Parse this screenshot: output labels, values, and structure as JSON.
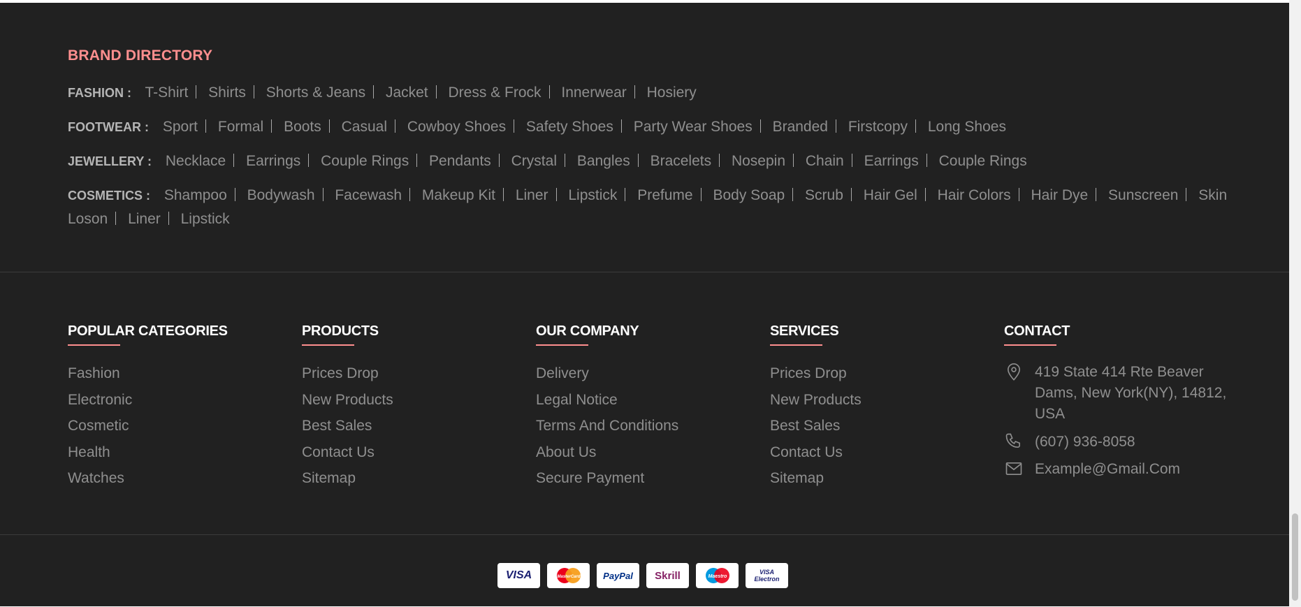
{
  "brand_directory": {
    "title": "BRAND DIRECTORY",
    "rows": [
      {
        "label": "FASHION :",
        "items": [
          "T-Shirt",
          "Shirts",
          "Shorts & Jeans",
          "Jacket",
          "Dress & Frock",
          "Innerwear",
          "Hosiery"
        ]
      },
      {
        "label": "FOOTWEAR :",
        "items": [
          "Sport",
          "Formal",
          "Boots",
          "Casual",
          "Cowboy Shoes",
          "Safety Shoes",
          "Party Wear Shoes",
          "Branded",
          "Firstcopy",
          "Long Shoes"
        ]
      },
      {
        "label": "JEWELLERY :",
        "items": [
          "Necklace",
          "Earrings",
          "Couple Rings",
          "Pendants",
          "Crystal",
          "Bangles",
          "Bracelets",
          "Nosepin",
          "Chain",
          "Earrings",
          "Couple Rings"
        ]
      },
      {
        "label": "COSMETICS :",
        "items": [
          "Shampoo",
          "Bodywash",
          "Facewash",
          "Makeup Kit",
          "Liner",
          "Lipstick",
          "Prefume",
          "Body Soap",
          "Scrub",
          "Hair Gel",
          "Hair Colors",
          "Hair Dye",
          "Sunscreen",
          "Skin Loson",
          "Liner",
          "Lipstick"
        ]
      }
    ]
  },
  "columns": {
    "popular": {
      "title": "POPULAR CATEGORIES",
      "items": [
        "Fashion",
        "Electronic",
        "Cosmetic",
        "Health",
        "Watches"
      ]
    },
    "products": {
      "title": "PRODUCTS",
      "items": [
        "Prices Drop",
        "New Products",
        "Best Sales",
        "Contact Us",
        "Sitemap"
      ]
    },
    "company": {
      "title": "OUR COMPANY",
      "items": [
        "Delivery",
        "Legal Notice",
        "Terms And Conditions",
        "About Us",
        "Secure Payment"
      ]
    },
    "services": {
      "title": "SERVICES",
      "items": [
        "Prices Drop",
        "New Products",
        "Best Sales",
        "Contact Us",
        "Sitemap"
      ]
    },
    "contact": {
      "title": "CONTACT",
      "address": "419 State 414 Rte Beaver Dams, New York(NY), 14812, USA",
      "phone": "(607) 936-8058",
      "email": "Example@Gmail.Com"
    }
  },
  "payments": [
    {
      "name": "VISA",
      "color": "#1a1f71"
    },
    {
      "name": "MasterCard",
      "color": "#eb001b"
    },
    {
      "name": "PayPal",
      "color": "#003087"
    },
    {
      "name": "Skrill",
      "color": "#862165"
    },
    {
      "name": "Maestro",
      "color": "#0099df"
    },
    {
      "name": "VISA Electron",
      "color": "#1a1f71"
    }
  ],
  "colors": {
    "background": "#212121",
    "accent": "#ff8f8f",
    "text": "#8f8f8f"
  }
}
